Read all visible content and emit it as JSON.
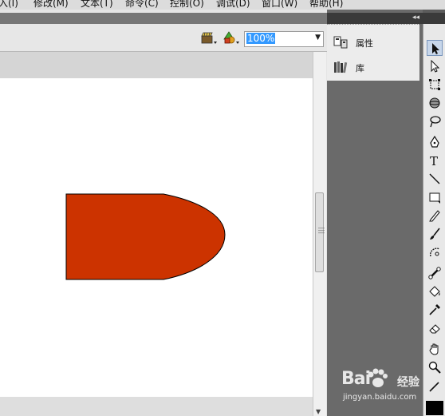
{
  "menu": {
    "items": [
      "入(I)",
      "修改(M)",
      "文本(T)",
      "命令(C)",
      "控制(O)",
      "调试(D)",
      "窗口(W)",
      "帮助(H)"
    ]
  },
  "toolbar": {
    "zoom_value": "100%",
    "edit_scene_icon": "clapper-icon",
    "edit_symbol_icon": "shapes-icon"
  },
  "panels": {
    "collapse_glyph": "◂◂",
    "items": [
      {
        "label": "属性",
        "icon": "properties-icon"
      },
      {
        "label": "库",
        "icon": "library-icon"
      }
    ]
  },
  "tools": [
    "selection-tool-icon",
    "subselection-tool-icon",
    "free-transform-tool-icon",
    "3d-rotation-tool-icon",
    "lasso-tool-icon",
    "pen-tool-icon",
    "text-tool-icon",
    "line-tool-icon",
    "rectangle-tool-icon",
    "pencil-tool-icon",
    "brush-tool-icon",
    "deco-tool-icon",
    "bone-tool-icon",
    "paint-bucket-tool-icon",
    "eyedropper-tool-icon",
    "eraser-tool-icon",
    "hand-tool-icon",
    "zoom-tool-icon"
  ],
  "colors": {
    "shape_fill": "#cc3300",
    "stroke_color": "#000000",
    "fill_color": "#000000",
    "selection_highlight": "#3399ff"
  },
  "watermark": {
    "brand": "Bai",
    "brand_cn": "经验",
    "url": "jingyan.baidu.com"
  }
}
